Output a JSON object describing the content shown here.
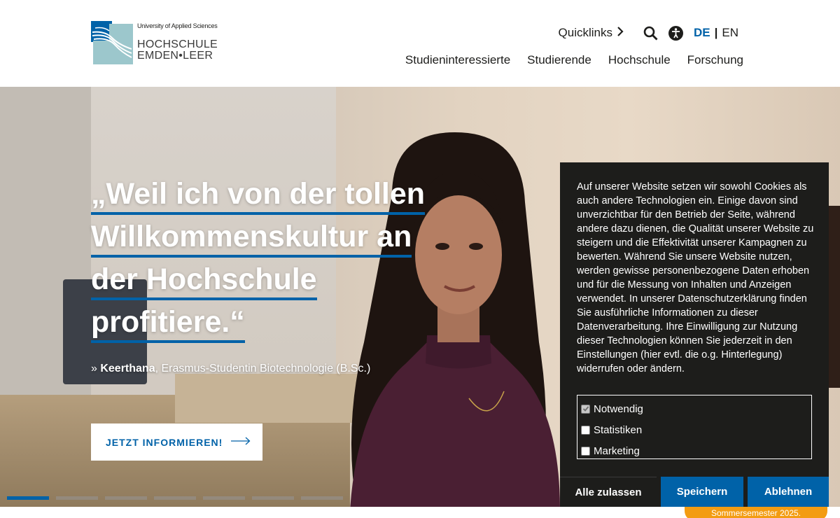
{
  "brand": {
    "tagline": "University of Applied Sciences",
    "name_line1": "HOCHSCHULE",
    "name_line2": "EMDEN•LEER"
  },
  "utility": {
    "quicklinks_label": "Quicklinks",
    "search_icon": "search-icon",
    "accessibility_icon": "accessibility-icon",
    "lang_de": "DE",
    "lang_sep": "|",
    "lang_en": "EN"
  },
  "nav": {
    "items": [
      {
        "label": "Studieninteressierte"
      },
      {
        "label": "Studierende"
      },
      {
        "label": "Hochschule"
      },
      {
        "label": "Forschung"
      }
    ]
  },
  "hero": {
    "quote_lines": [
      "„Weil ich von der tollen",
      "Willkommenskultur an",
      "der Hochschule",
      "profitiere.“"
    ],
    "attribution_prefix": "» ",
    "attribution_name": "Keerthana",
    "attribution_rest": ", Erasmus-Studentin Biotechnologie (B.Sc.)",
    "cta_label": "JETZT INFORMIEREN!",
    "slides_total": 7,
    "slide_active": 1
  },
  "cookie": {
    "text": "Auf unserer Website setzen wir sowohl Cookies als auch andere Technologien ein. Einige davon sind unverzichtbar für den Betrieb der Seite, während andere dazu dienen, die Qualität unserer Website zu steigern und die Effektivität unserer Kampagnen zu bewerten. Während Sie unsere Website nutzen, werden gewisse personenbezogene Daten erhoben und für die Messung von Inhalten und Anzeigen verwendet. In unserer Datenschutzerklärung finden Sie ausführliche Informationen zu dieser Datenverarbeitung. Ihre Einwilligung zur Nutzung dieser Technologien können Sie jederzeit in den Einstellungen (hier evtl. die o.g. Hinterlegung) widerrufen oder ändern.",
    "options": [
      {
        "label": "Notwendig",
        "checked": true,
        "disabled": true
      },
      {
        "label": "Statistiken",
        "checked": false
      },
      {
        "label": "Marketing",
        "checked": false
      }
    ],
    "allow_all": "Alle zulassen",
    "save": "Speichern",
    "deny": "Ablehnen"
  },
  "badge_text": "Sommersemester 2025.",
  "colors": {
    "brand_blue": "#0062a8",
    "banner_bg": "#1d1d1b",
    "badge_orange": "#f39c12"
  }
}
